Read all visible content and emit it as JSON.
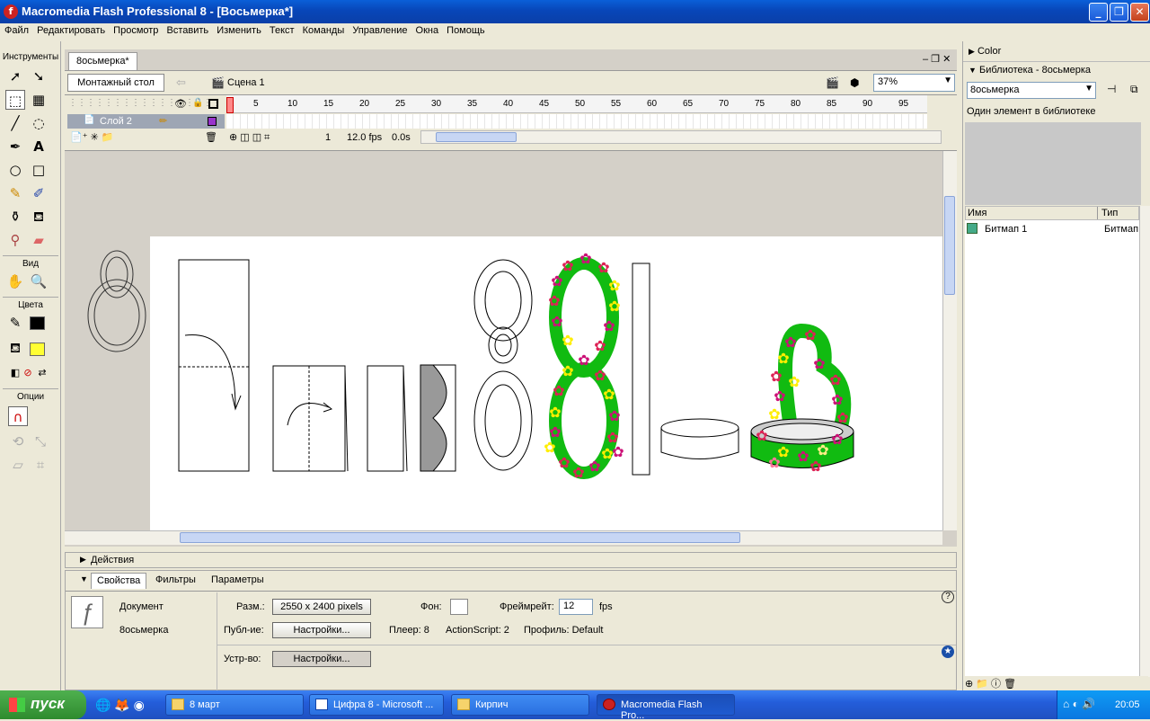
{
  "window": {
    "title": "Macromedia Flash Professional 8 - [Восьмерка*]"
  },
  "menu": [
    "Файл",
    "Редактировать",
    "Просмотр",
    "Вставить",
    "Изменить",
    "Текст",
    "Команды",
    "Управление",
    "Окна",
    "Помощь"
  ],
  "tools": {
    "title": "Инструменты",
    "view_label": "Вид",
    "colors_label": "Цвета",
    "options_label": "Опции"
  },
  "document": {
    "tab": "8осьмерка*",
    "stage_button": "Монтажный стол",
    "scene": "Сцена 1",
    "zoom": "37%"
  },
  "timeline": {
    "ruler": [
      "1",
      "5",
      "10",
      "15",
      "20",
      "25",
      "30",
      "35",
      "40",
      "45",
      "50",
      "55",
      "60",
      "65",
      "70",
      "75",
      "80",
      "85",
      "90",
      "95"
    ],
    "layer": "Слой 2",
    "frame": "1",
    "fps": "12.0 fps",
    "time": "0.0s"
  },
  "actions_panel": {
    "label": "Действия"
  },
  "properties": {
    "tabs": [
      "Свойства",
      "Фильтры",
      "Параметры"
    ],
    "doc_label": "Документ",
    "doc_name": "8осьмерка",
    "size_label": "Разм.:",
    "size_value": "2550 x 2400 pixels",
    "bg_label": "Фон:",
    "framerate_label": "Фреймрейт:",
    "framerate_value": "12",
    "fps_unit": "fps",
    "publish_label": "Публ-ие:",
    "settings_btn": "Настройки...",
    "player": "Плеер: 8",
    "actionscript": "ActionScript:  2",
    "profile": "Профиль: Default",
    "device_label": "Устр-во:",
    "device_btn": "Настройки..."
  },
  "right_panel": {
    "color_title": "Color",
    "library_title": "Библиотека - 8осьмерка",
    "library_select": "8осьмерка",
    "library_info": "Один элемент в библиотеке",
    "col_name": "Имя",
    "col_type": "Тип",
    "item_name": "Битмап 1",
    "item_type": "Битмап"
  },
  "taskbar": {
    "start": "пуск",
    "tasks": [
      "8 март",
      "Цифра 8 - Microsoft ...",
      "Кирпич",
      "Macromedia Flash Pro..."
    ],
    "clock": "20:05"
  },
  "colors": {
    "stroke": "#000000",
    "fill": "#ffff33",
    "titlebar": "#0a4fc8"
  }
}
